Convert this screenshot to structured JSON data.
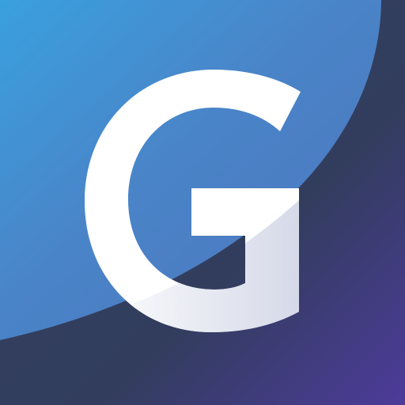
{
  "logo": {
    "letter": "G",
    "colors": {
      "dark_base": "#2e3a5a",
      "dark_purple": "#4a3c98",
      "light_blue": "#4a7fc6",
      "sky_blue": "#3aa0de",
      "letter_white": "#ffffff",
      "letter_shadow": "#d7dbea"
    }
  }
}
